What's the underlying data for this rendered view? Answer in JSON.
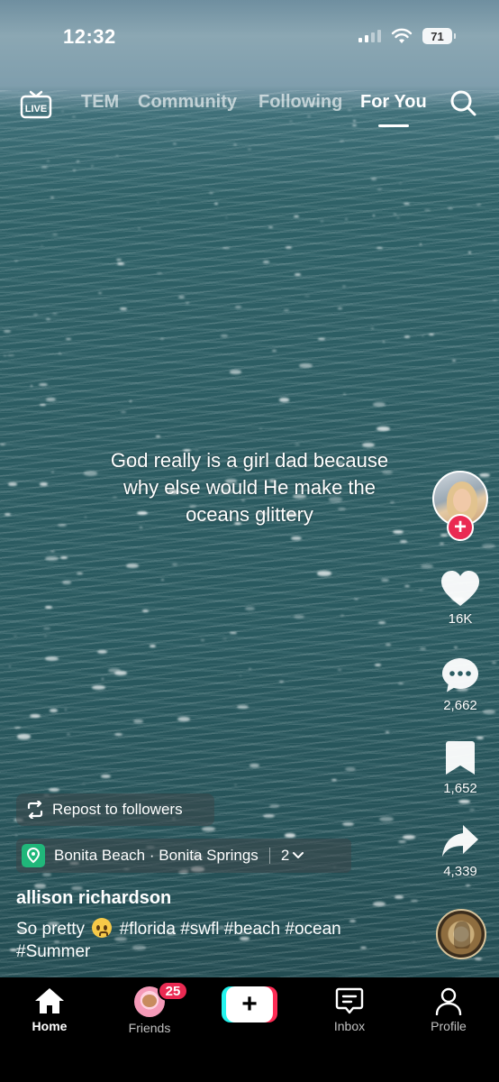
{
  "status_bar": {
    "time": "12:32",
    "battery": "71"
  },
  "top_nav": {
    "tabs": [
      {
        "label": "TEM"
      },
      {
        "label": "Community"
      },
      {
        "label": "Following"
      },
      {
        "label": "For You"
      }
    ],
    "active_tab": "For You",
    "live_label": "LIVE"
  },
  "video": {
    "overlay_text": "God really is a girl dad because why else would He make the oceans glittery"
  },
  "actions": {
    "likes": "16K",
    "comments": "2,662",
    "bookmarks": "1,652",
    "shares": "4,339"
  },
  "post": {
    "repost_label": "Repost to followers",
    "location": "Bonita Beach · Bonita Springs",
    "location_count": "2",
    "username": "allison richardson",
    "caption_before_emoji": "So pretty",
    "caption_after_emoji": "#florida #swfl #beach #ocean #Summer"
  },
  "tabbar": {
    "home": "Home",
    "friends": "Friends",
    "friends_badge": "25",
    "inbox": "Inbox",
    "profile": "Profile"
  },
  "colors": {
    "accent": "#ea2a52",
    "location_icon": "#20b77a",
    "create_cyan": "#25f4ee",
    "create_red": "#fe2c55"
  }
}
